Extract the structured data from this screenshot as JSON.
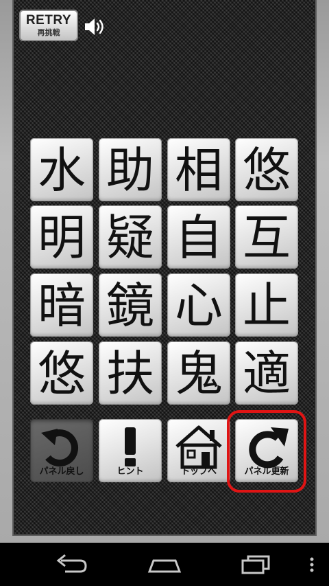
{
  "header": {
    "retry_label": "RETRY",
    "retry_sublabel": "再挑戦",
    "sound_icon": "speaker-icon"
  },
  "board": {
    "tiles": [
      "水",
      "助",
      "相",
      "悠",
      "明",
      "疑",
      "自",
      "互",
      "暗",
      "鏡",
      "心",
      "止",
      "悠",
      "扶",
      "鬼",
      "適"
    ]
  },
  "controls": {
    "undo_label": "パネル戻し",
    "hint_label": "ヒント",
    "top_label": "トップへ",
    "refresh_label": "パネル更新"
  },
  "highlight_color": "#e01414",
  "navbar": {
    "back_icon": "back-arrow-icon",
    "home_icon": "home-icon",
    "recents_icon": "recent-apps-icon",
    "menu_icon": "overflow-menu-icon"
  }
}
